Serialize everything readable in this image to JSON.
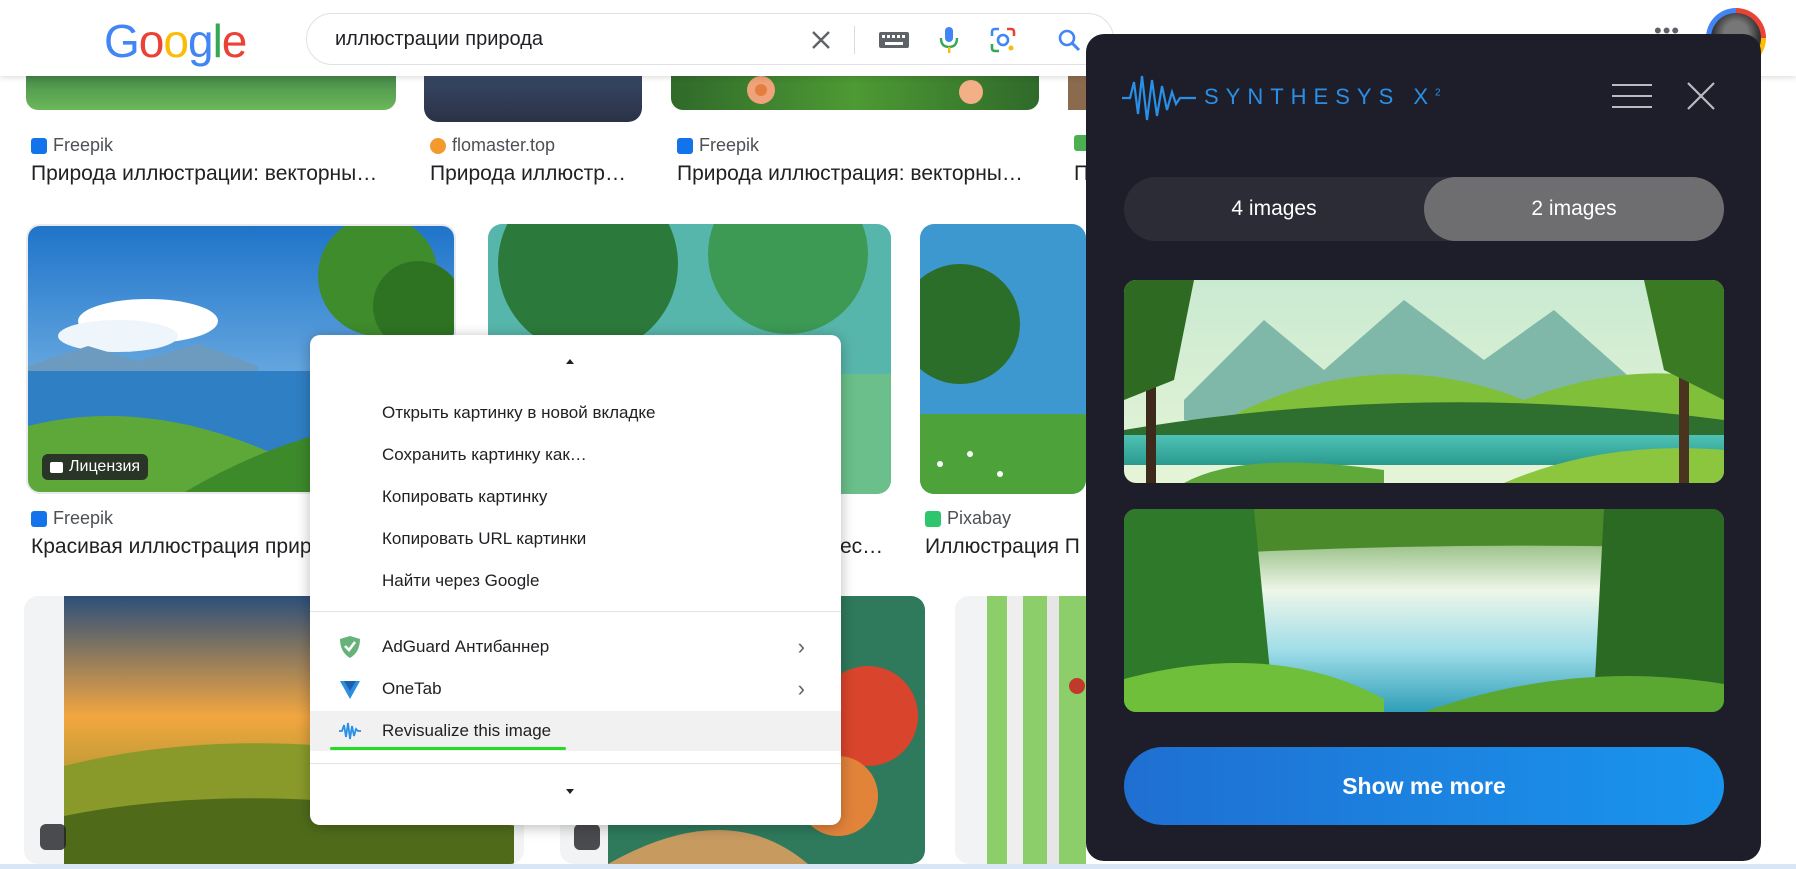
{
  "header": {
    "logo_text": "Google",
    "search_query": "иллюстрации природа"
  },
  "results": {
    "row1": [
      {
        "source": "Freepik",
        "title": "Природа иллюстрации: векторны…"
      },
      {
        "source": "flomaster.top",
        "title": "Природа иллюстр…"
      },
      {
        "source": "Freepik",
        "title": "Природа иллюстрация: векторны…"
      },
      {
        "source": "",
        "title": "П"
      }
    ],
    "row2": [
      {
        "source": "Freepik",
        "title": "Красивая иллюстрация прир",
        "badge": "Лицензия"
      },
      {
        "source": "",
        "title": "ес…"
      },
      {
        "source": "Pixabay",
        "title": "Иллюстрация П"
      }
    ]
  },
  "context_menu": {
    "items": [
      "Открыть картинку в новой вкладке",
      "Сохранить картинку как…",
      "Копировать картинку",
      "Копировать URL картинки",
      "Найти через Google"
    ],
    "extensions": [
      {
        "label": "AdGuard Антибаннер",
        "icon": "adguard-shield-icon",
        "submenu": true
      },
      {
        "label": "OneTab",
        "icon": "onetab-funnel-icon",
        "submenu": true
      },
      {
        "label": "Revisualize this image",
        "icon": "synthesys-wave-icon",
        "submenu": false,
        "highlighted": true
      }
    ]
  },
  "panel": {
    "brand": "SYNTHESYS X",
    "brand_sup": "2",
    "tabs": [
      "4 images",
      "2 images"
    ],
    "active_tab": "2 images",
    "button": "Show me more",
    "accent": "#2a8fe6",
    "background": "#1e1e2a"
  }
}
